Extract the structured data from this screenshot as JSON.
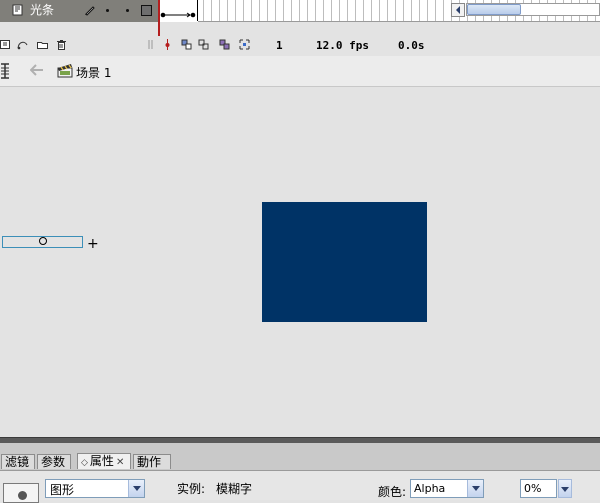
{
  "timeline": {
    "layer_name": "光条",
    "current_frame": "1",
    "frame_rate": "12.0 fps",
    "elapsed_time": "0.0s"
  },
  "edit_bar": {
    "scene_name": "场景 1"
  },
  "stage": {
    "rectangle_color": "#003366"
  },
  "property_inspector": {
    "tabs": [
      "滤镜",
      "参数",
      "属性",
      "動作"
    ],
    "active_tab": "属性",
    "symbol_type": "图形",
    "instance_label": "实例:",
    "instance_name": "模糊字",
    "color_label": "颜色:",
    "color_mode": "Alpha",
    "alpha_value": "0%"
  }
}
